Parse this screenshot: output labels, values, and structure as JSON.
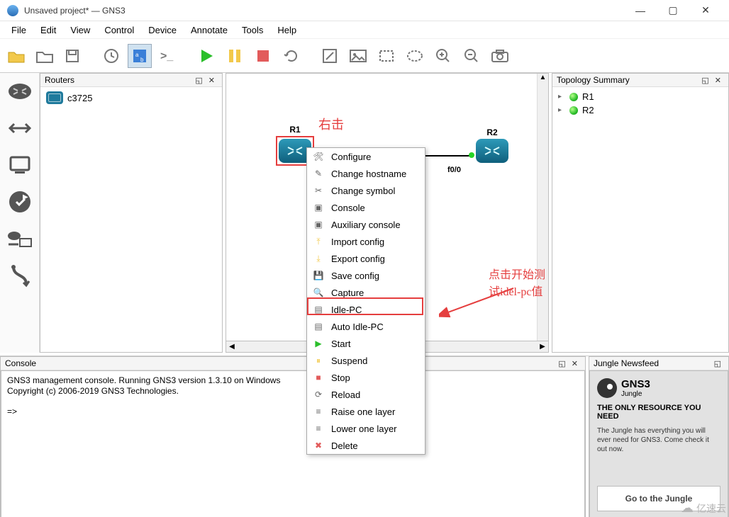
{
  "window": {
    "title": "Unsaved project* — GNS3",
    "min": "—",
    "max": "▢",
    "close": "✕"
  },
  "menu": [
    "File",
    "Edit",
    "View",
    "Control",
    "Device",
    "Annotate",
    "Tools",
    "Help"
  ],
  "sidebar_tools": [
    "router-tool",
    "switch-tool",
    "pc-tool",
    "vpcs-tool",
    "hub-tool",
    "security-tool",
    "cable-tool"
  ],
  "routers_panel": {
    "title": "Routers",
    "items": [
      "c3725"
    ]
  },
  "topology": {
    "title": "Topology Summary",
    "items": [
      "R1",
      "R2"
    ]
  },
  "canvas": {
    "r1_label": "R1",
    "r2_label": "R2",
    "port_label": "f0/0",
    "hint_right_click": "右击",
    "hint_idlepc": "点击开始测试idel-pc值"
  },
  "context_menu": [
    {
      "icon": "🛠",
      "label": "Configure"
    },
    {
      "icon": "✎",
      "label": "Change hostname"
    },
    {
      "icon": "✂",
      "label": "Change symbol"
    },
    {
      "icon": "▣",
      "label": "Console"
    },
    {
      "icon": "▣",
      "label": "Auxiliary console"
    },
    {
      "icon": "⤒",
      "label": "Import config"
    },
    {
      "icon": "⤓",
      "label": "Export config"
    },
    {
      "icon": "💾",
      "label": "Save config"
    },
    {
      "icon": "🔍",
      "label": "Capture"
    },
    {
      "icon": "▤",
      "label": "Idle-PC"
    },
    {
      "icon": "▤",
      "label": "Auto Idle-PC"
    },
    {
      "icon": "▶",
      "label": "Start"
    },
    {
      "icon": "⏸",
      "label": "Suspend"
    },
    {
      "icon": "■",
      "label": "Stop"
    },
    {
      "icon": "⟳",
      "label": "Reload"
    },
    {
      "icon": "≡",
      "label": "Raise one layer"
    },
    {
      "icon": "≡",
      "label": "Lower one layer"
    },
    {
      "icon": "✖",
      "label": "Delete"
    }
  ],
  "console": {
    "title": "Console",
    "line1": "GNS3 management console. Running GNS3 version 1.3.10 on Windows",
    "line2": "Copyright (c) 2006-2019 GNS3 Technologies.",
    "prompt": "=>"
  },
  "newsfeed": {
    "title": "Jungle Newsfeed",
    "brand": "GNS3",
    "sub": "Jungle",
    "heading": "THE ONLY RESOURCE YOU NEED",
    "body": "The Jungle has everything you will ever need for GNS3. Come check it out now.",
    "button": "Go to the Jungle"
  },
  "watermark": "亿速云"
}
